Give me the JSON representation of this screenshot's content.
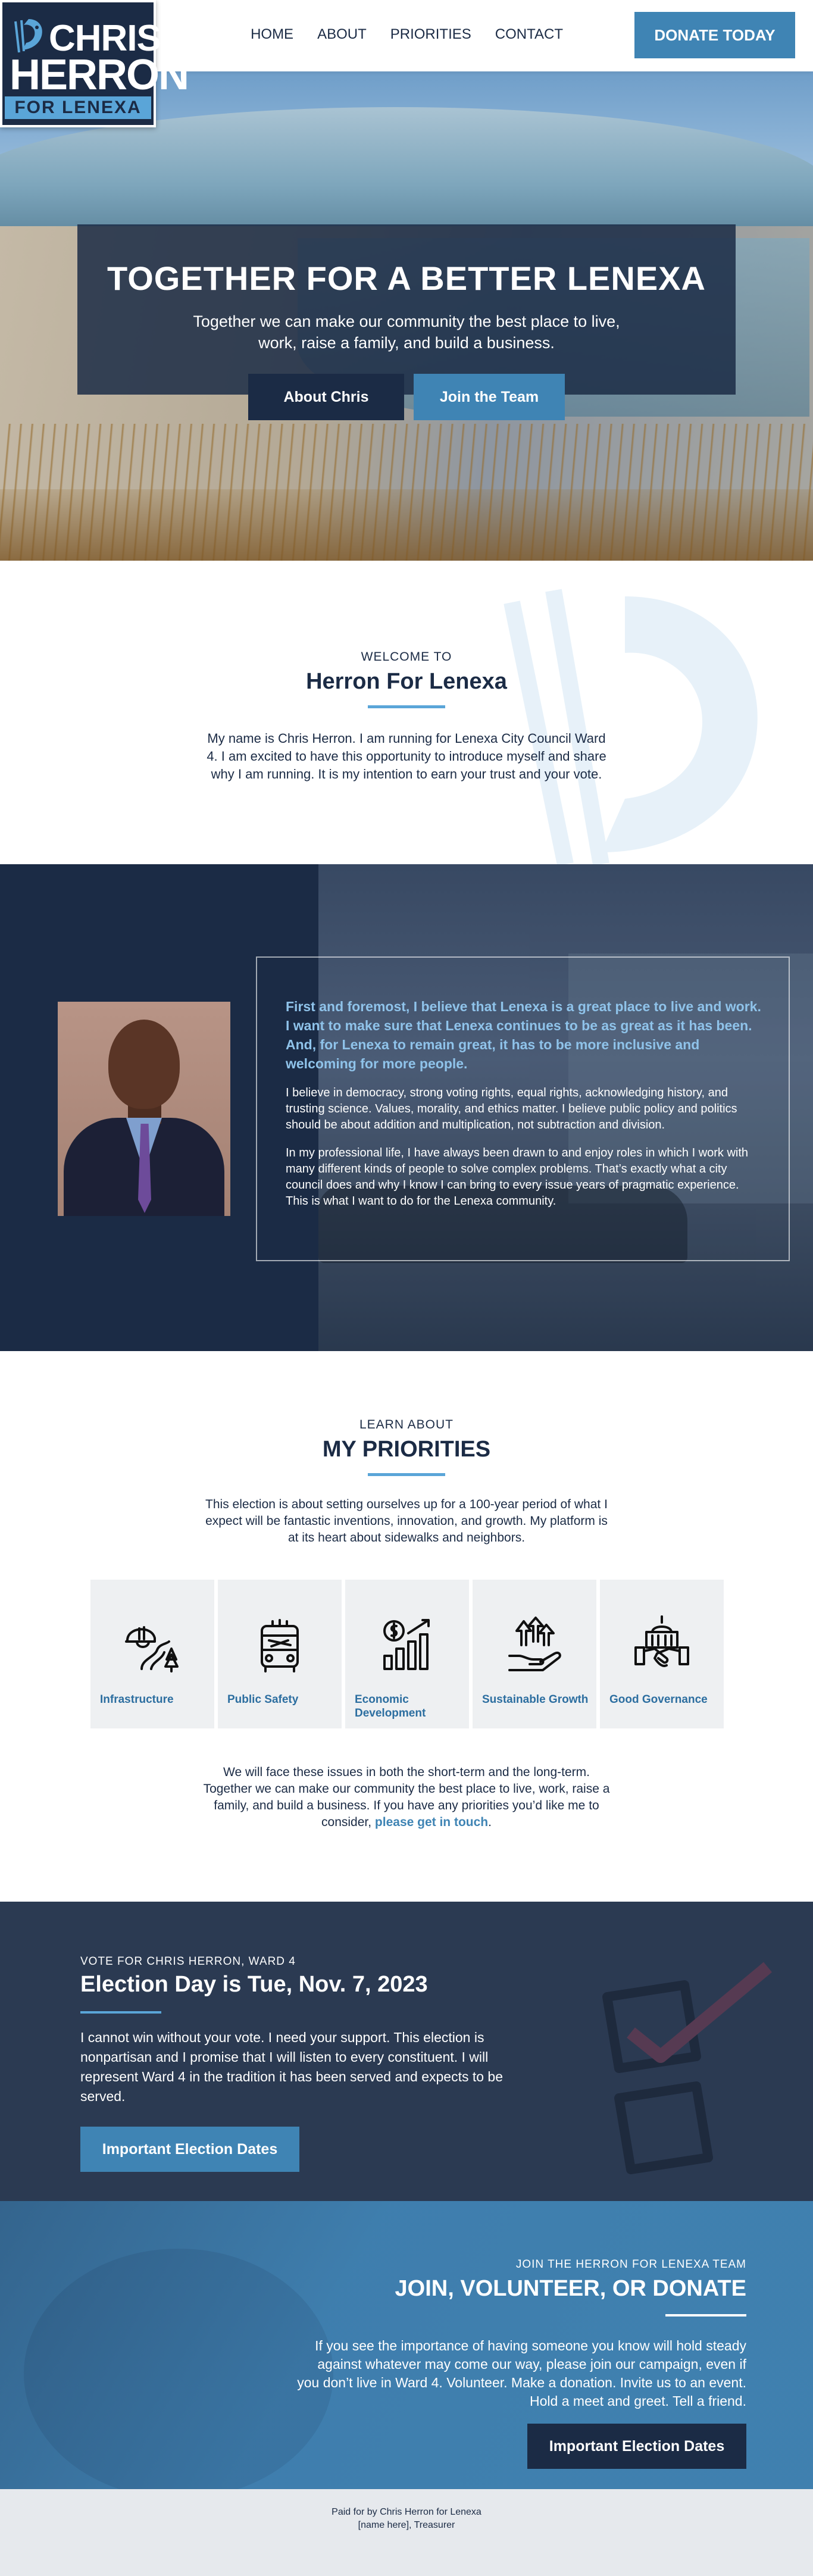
{
  "logo": {
    "line1": "CHRIS",
    "line2": "HERRON",
    "line3": "FOR LENEXA"
  },
  "nav": {
    "items": [
      "HOME",
      "ABOUT",
      "PRIORITIES",
      "CONTACT"
    ],
    "donate_label": "DONATE TODAY"
  },
  "hero": {
    "title": "TOGETHER FOR A BETTER LENEXA",
    "subtitle": "Together we can make our community the best place to live, work, raise a family, and build a business.",
    "btn_about": "About Chris",
    "btn_join": "Join the Team"
  },
  "welcome": {
    "eyebrow": "WELCOME TO",
    "title": "Herron For Lenexa",
    "body": "My name is Chris Herron. I am running for Lenexa City Council Ward 4. I am excited to have this opportunity to introduce myself and share why I am running. It is my intention to earn your trust and your vote."
  },
  "believe": {
    "lead": "First and foremost, I believe that Lenexa is a great place to live and work. I want to make sure that Lenexa continues to be as great as it has been. And, for Lenexa to remain great, it has to be more inclusive and welcoming for more people.",
    "p1": "I believe in democracy, strong voting rights, equal rights, acknowledging history, and trusting science. Values, morality, and ethics matter. I believe public policy and politics should be about addition and multiplication, not subtraction and division.",
    "p2": "In my professional life, I have always been drawn to and enjoy roles in which I work with many different kinds of people to solve complex problems. That’s exactly what a city council does and why I know I can bring to every issue years of pragmatic experience. This is what I want to do for the Lenexa community."
  },
  "priorities": {
    "eyebrow": "LEARN ABOUT",
    "title": "MY PRIORITIES",
    "intro": "This election is about setting ourselves up for a 100-year period of what I expect will be fantastic inventions, innovation, and growth. My platform is at its heart about sidewalks and neighbors.",
    "cards": [
      {
        "label": "Infrastructure",
        "icon": "infrastructure-icon"
      },
      {
        "label": "Public Safety",
        "icon": "fire-truck-icon"
      },
      {
        "label": "Economic Development",
        "icon": "growth-chart-icon"
      },
      {
        "label": "Sustainable Growth",
        "icon": "hand-arrows-icon"
      },
      {
        "label": "Good Governance",
        "icon": "capitol-handshake-icon"
      }
    ],
    "outro": "We will face these issues in both the short-term and the long-term. Together we can make our community the best place to live, work, raise a family, and build a business. If you have any priorities you’d like me to consider,",
    "outro_link": "please get in touch",
    "outro_end": "."
  },
  "election": {
    "eyebrow": "VOTE FOR CHRIS HERRON, WARD 4",
    "title": "Election Day is Tue, Nov. 7, 2023",
    "body": "I cannot win without your vote. I need your support. This election is nonpartisan and I promise that I will listen to every constituent. I will represent Ward 4 in the tradition it has been served and expects to be served.",
    "button": "Important Election Dates"
  },
  "join": {
    "eyebrow": "JOIN THE HERRON FOR LENEXA TEAM",
    "title": "JOIN, VOLUNTEER, OR DONATE",
    "body": "If you see the importance of having someone you know will hold steady against whatever may come our way, please join our campaign, even if you don’t live in Ward 4. Volunteer. Make a donation. Invite us to an event. Hold a meet and greet. Tell a friend.",
    "button": "Important Election Dates"
  },
  "footer": {
    "line1": "Paid for by Chris Herron for Lenexa",
    "line2": "[name here], Treasurer"
  },
  "colors": {
    "navy": "#1b2b45",
    "accent_blue": "#3f84b4",
    "light_blue": "#5aa5d8"
  }
}
